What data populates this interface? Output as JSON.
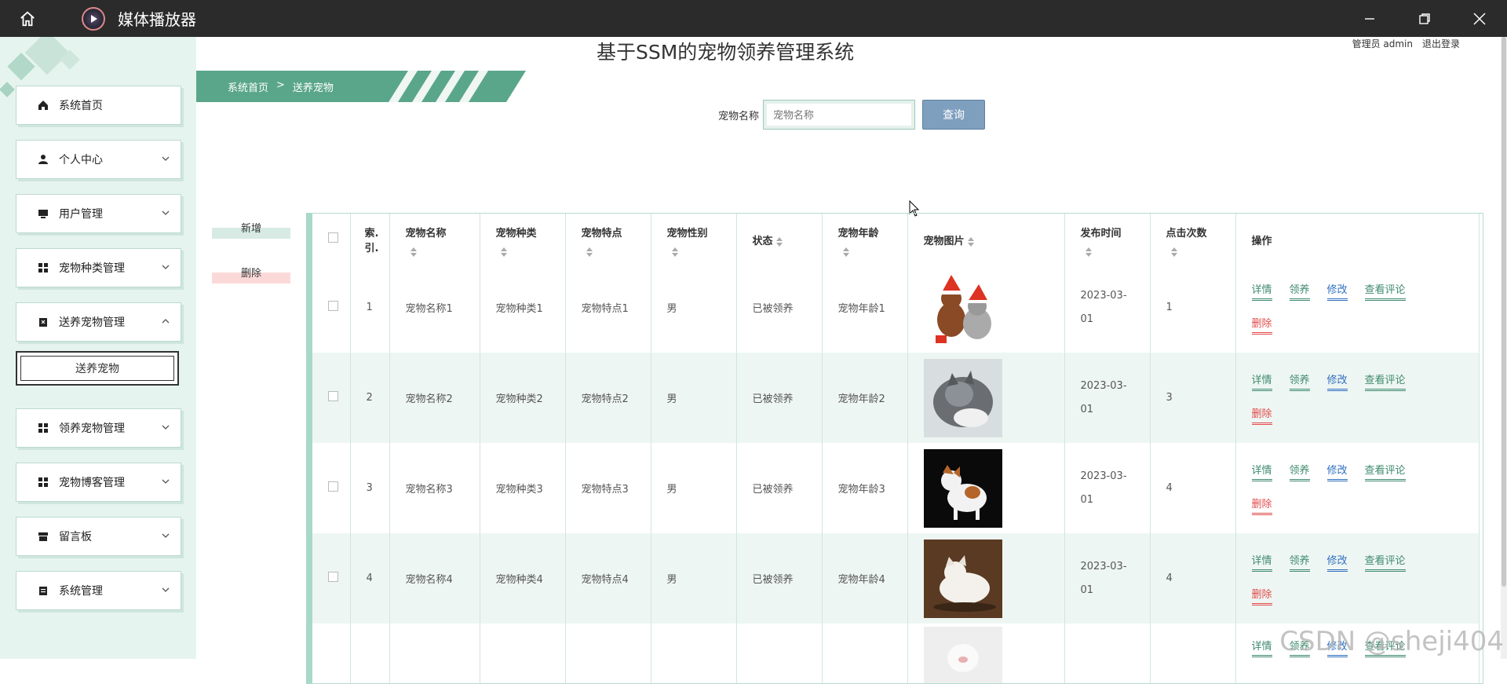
{
  "window": {
    "title": "媒体播放器"
  },
  "colors": {
    "accent": "#5aa68a",
    "sidebar_bg": "#e6f4ef",
    "search_btn": "#7f9fbf",
    "danger": "#e24b4b",
    "link_blue": "#2f6fbf"
  },
  "sidebar": {
    "items": [
      {
        "label": "系统首页",
        "icon": "home-icon"
      },
      {
        "label": "个人中心",
        "icon": "user-icon"
      },
      {
        "label": "用户管理",
        "icon": "monitor-icon"
      },
      {
        "label": "宠物种类管理",
        "icon": "grid-icon"
      },
      {
        "label": "送养宠物管理",
        "icon": "clipboard-icon"
      },
      {
        "label": "领养宠物管理",
        "icon": "grid-icon"
      },
      {
        "label": "宠物博客管理",
        "icon": "grid-icon"
      },
      {
        "label": "留言板",
        "icon": "store-icon"
      },
      {
        "label": "系统管理",
        "icon": "clipboard-icon"
      }
    ],
    "submenu_label": "送养宠物"
  },
  "header": {
    "title": "基于SSM的宠物领养管理系统",
    "user": "管理员 admin",
    "logout": "退出登录",
    "breadcrumb": [
      "系统首页",
      ">",
      "送养宠物"
    ]
  },
  "search": {
    "label": "宠物名称",
    "placeholder": "宠物名称",
    "button": "查询"
  },
  "actions": {
    "add": "新增",
    "delete": "删除"
  },
  "table": {
    "columns": [
      "索引",
      "宠物名称",
      "宠物种类",
      "宠物特点",
      "宠物性别",
      "状态",
      "宠物年龄",
      "宠物图片",
      "发布时间",
      "点击次数",
      "操作"
    ],
    "index_label": [
      "索.",
      "引."
    ],
    "time_lines": [
      "2023-03-",
      "01"
    ],
    "ops": [
      "详情",
      "领养",
      "修改",
      "查看评论",
      "删除"
    ],
    "rows": [
      {
        "index": "1",
        "name": "宠物名称1",
        "kind": "宠物种类1",
        "feature": "宠物特点1",
        "gender": "男",
        "status": "已被领养",
        "age": "宠物年龄1",
        "clicks": "1"
      },
      {
        "index": "2",
        "name": "宠物名称2",
        "kind": "宠物种类2",
        "feature": "宠物特点2",
        "gender": "男",
        "status": "已被领养",
        "age": "宠物年龄2",
        "clicks": "3"
      },
      {
        "index": "3",
        "name": "宠物名称3",
        "kind": "宠物种类3",
        "feature": "宠物特点3",
        "gender": "男",
        "status": "已被领养",
        "age": "宠物年龄3",
        "clicks": "4"
      },
      {
        "index": "4",
        "name": "宠物名称4",
        "kind": "宠物种类4",
        "feature": "宠物特点4",
        "gender": "男",
        "status": "已被领养",
        "age": "宠物年龄4",
        "clicks": "4"
      }
    ]
  },
  "watermark": "CSDN @sheji404"
}
